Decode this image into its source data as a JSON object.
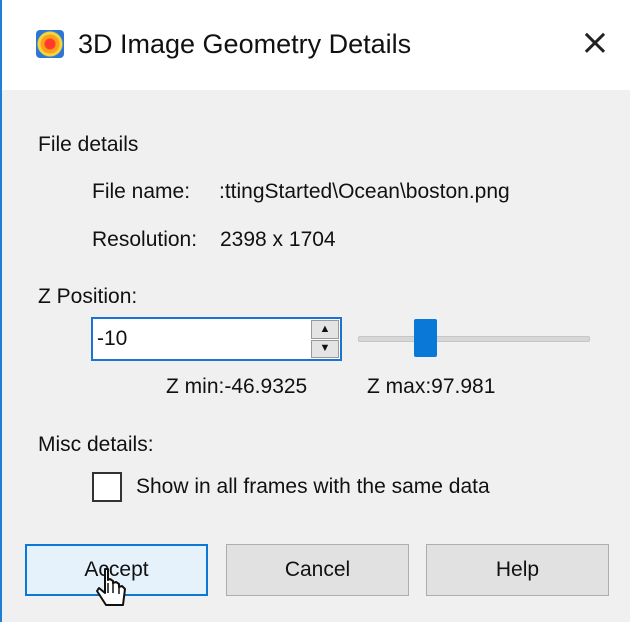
{
  "window": {
    "title": "3D Image Geometry Details",
    "close_label": "×",
    "app_icon": "tecplot-app-icon"
  },
  "file_details": {
    "heading": "File details",
    "file_name_label": "File name:",
    "file_name_value": ":ttingStarted\\Ocean\\boston.png",
    "resolution_label": "Resolution:",
    "resolution_value": "2398 x 1704"
  },
  "z_position": {
    "heading": "Z Position:",
    "value": "-10",
    "zmin_text": "Z min:-46.9325",
    "zmax_text": "Z max:97.981",
    "slider_fraction": 0.25
  },
  "misc": {
    "heading": "Misc details:",
    "checkbox_label": "Show in all frames with the same data",
    "checkbox_checked": false
  },
  "buttons": {
    "accept": "Accept",
    "cancel": "Cancel",
    "help": "Help"
  },
  "colors": {
    "accent": "#0a78d7",
    "window_bg": "#f0f0f0"
  }
}
